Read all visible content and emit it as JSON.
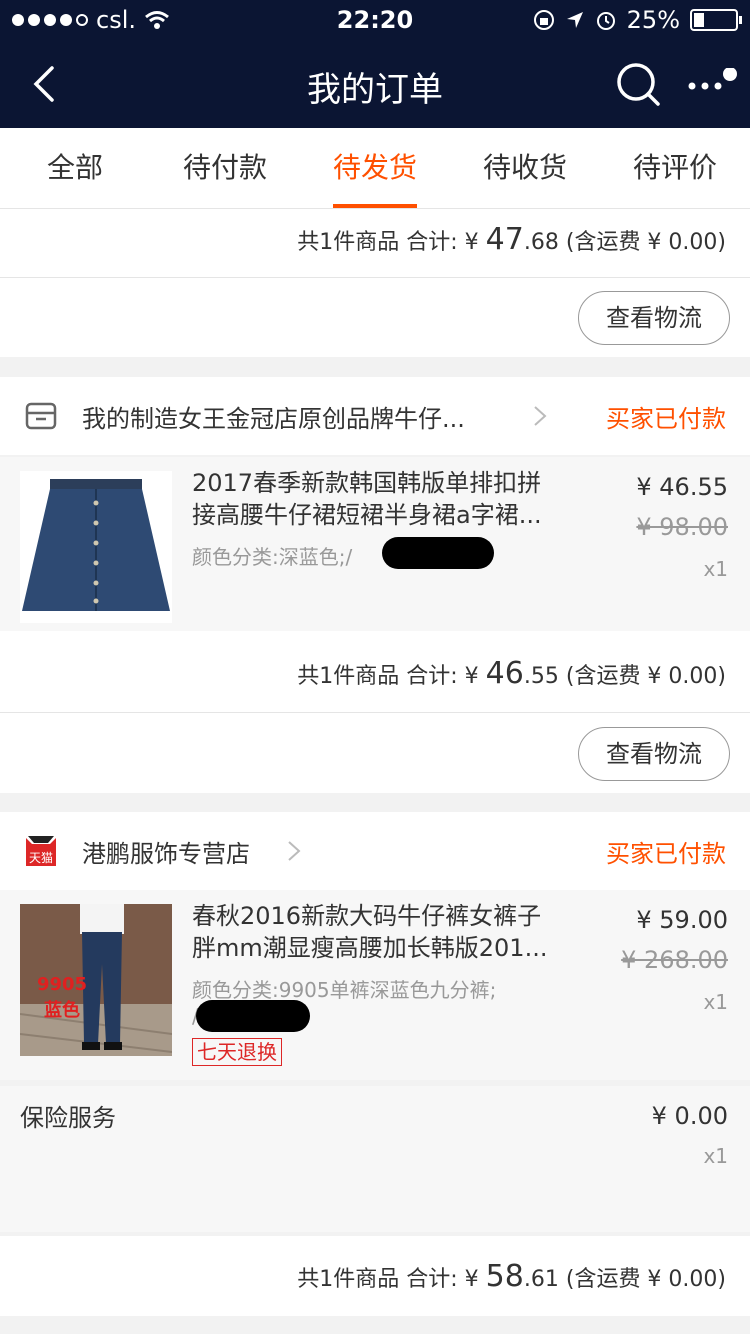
{
  "status": {
    "carrier": "csl.",
    "time": "22:20",
    "battery": "25%",
    "battery_level": 0.25
  },
  "nav": {
    "title": "我的订单",
    "back_icon": "back-arrow-icon",
    "search_icon": "search-icon",
    "more_icon": "more-icon"
  },
  "tabs": [
    {
      "label": "全部",
      "active": false
    },
    {
      "label": "待付款",
      "active": false
    },
    {
      "label": "待发货",
      "active": true
    },
    {
      "label": "待收货",
      "active": false
    },
    {
      "label": "待评价",
      "active": false
    }
  ],
  "orders": [
    {
      "summary": {
        "count_text": "共1件商品 合计:",
        "currency": "¥",
        "total_int": "47",
        "total_dec": ".68",
        "shipping_text": "(含运费 ¥ 0.00)"
      },
      "action": "查看物流"
    },
    {
      "store": {
        "name": "我的制造女王金冠店原创品牌牛仔...",
        "status": "买家已付款",
        "icon": "shop-icon"
      },
      "item": {
        "title_line1": "2017春季新款韩国韩版单排扣拼",
        "title_line2": "接高腰牛仔裙短裙半身裙a字裙...",
        "spec": "颜色分类:深蓝色;/",
        "price": "¥ 46.55",
        "original_price": "¥ 98.00",
        "quantity": "x1"
      },
      "summary": {
        "count_text": "共1件商品 合计:",
        "currency": "¥",
        "total_int": "46",
        "total_dec": ".55",
        "shipping_text": "(含运费 ¥ 0.00)"
      },
      "action": "查看物流"
    },
    {
      "store": {
        "name": "港鹏服饰专营店",
        "status": "买家已付款",
        "icon": "tmall-icon",
        "icon_label": "天猫"
      },
      "item": {
        "title_line1": "春秋2016新款大码牛仔裤女裤子",
        "title_line2": "胖mm潮显瘦高腰加长韩版201...",
        "spec": "颜色分类:9905单裤深蓝色九分裤;",
        "spec_line2": "/",
        "image_text_1": "9905",
        "image_text_2": "蓝色",
        "badge": "七天退换",
        "price": "¥ 59.00",
        "original_price": "¥ 268.00",
        "quantity": "x1"
      },
      "insurance": {
        "label": "保险服务",
        "price": "¥ 0.00",
        "quantity": "x1"
      },
      "summary": {
        "count_text": "共1件商品 合计:",
        "currency": "¥",
        "total_int": "58",
        "total_dec": ".61",
        "shipping_text": "(含运费 ¥ 0.00)"
      }
    }
  ],
  "colors": {
    "nav_bg": "#0b1533",
    "accent": "#ff5000",
    "tmall_red": "#dd2727"
  }
}
